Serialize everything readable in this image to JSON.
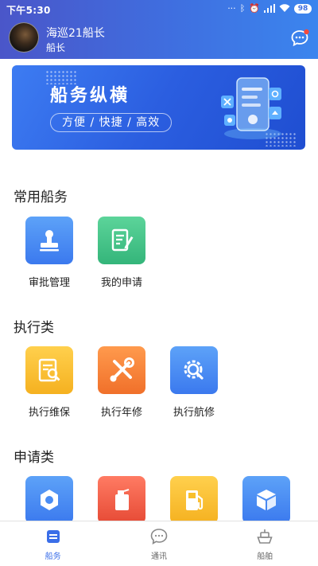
{
  "status_bar": {
    "time": "下午5:30",
    "battery": "98"
  },
  "header": {
    "user_name": "海巡21船长",
    "user_role": "船长"
  },
  "banner": {
    "title": "船务纵横",
    "subtitle": "方便 / 快捷 / 高效"
  },
  "sections": [
    {
      "title": "常用船务",
      "items": [
        {
          "label": "审批管理",
          "icon": "stamp-icon",
          "color": "#4a8df4"
        },
        {
          "label": "我的申请",
          "icon": "document-edit-icon",
          "color": "#3fbf84"
        }
      ]
    },
    {
      "title": "执行类",
      "items": [
        {
          "label": "执行维保",
          "icon": "inspection-doc-icon",
          "color": "#f8bf2c"
        },
        {
          "label": "执行年修",
          "icon": "tools-icon",
          "color": "#f47d35"
        },
        {
          "label": "执行航修",
          "icon": "gear-search-icon",
          "color": "#4a8df4"
        }
      ]
    },
    {
      "title": "申请类",
      "items": [
        {
          "label": "",
          "icon": "nut-icon",
          "color": "#4a8df4"
        },
        {
          "label": "",
          "icon": "oil-can-icon",
          "color": "#ec5a42"
        },
        {
          "label": "",
          "icon": "fuel-pump-icon",
          "color": "#f8bf2c"
        },
        {
          "label": "",
          "icon": "box-icon",
          "color": "#4a8df4"
        }
      ]
    }
  ],
  "tabs": [
    {
      "label": "船务",
      "icon": "ship-affairs-icon",
      "active": true
    },
    {
      "label": "通讯",
      "icon": "chat-icon",
      "active": false
    },
    {
      "label": "船舶",
      "icon": "ship-icon",
      "active": false
    }
  ],
  "colors": {
    "header_start": "#4a56c9",
    "header_end": "#3b85ee",
    "accent": "#3a6ee8"
  }
}
